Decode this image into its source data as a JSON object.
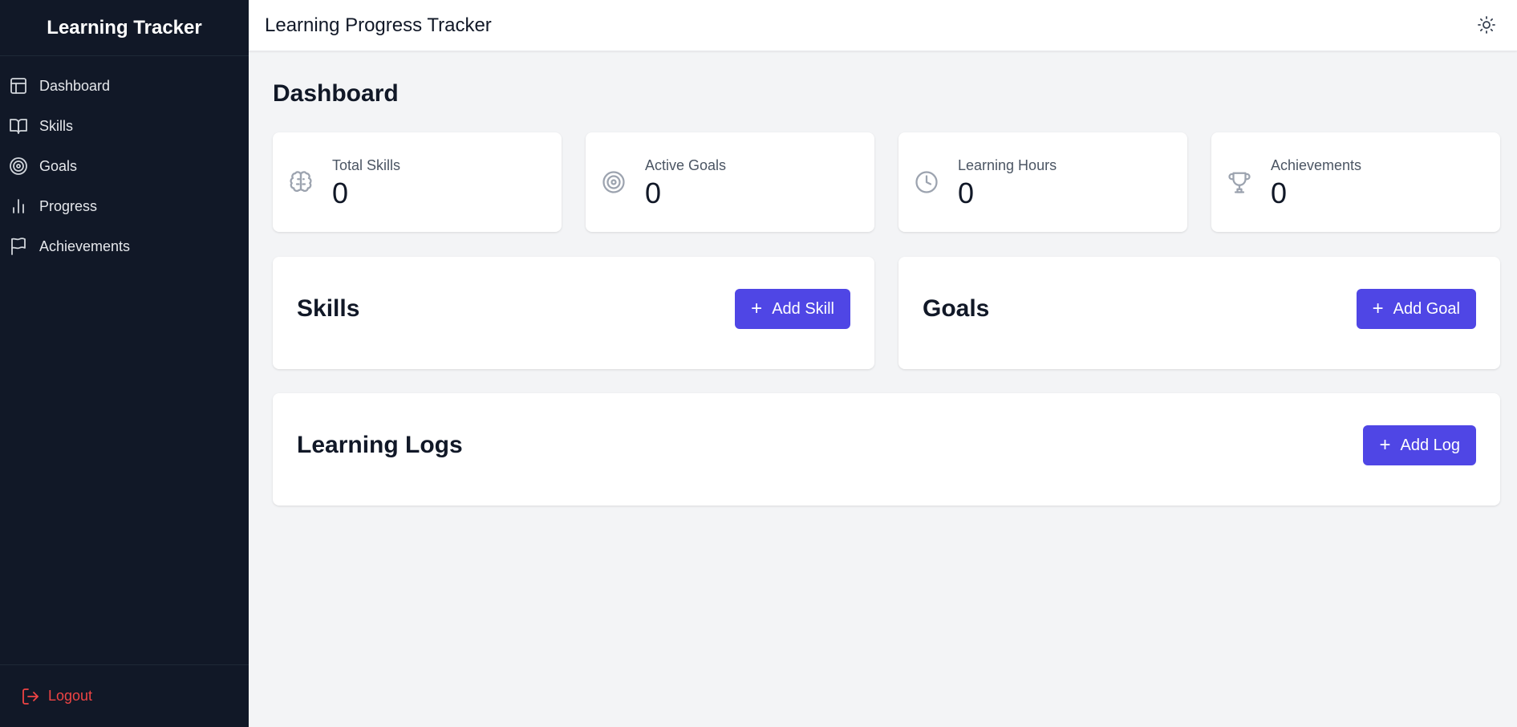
{
  "sidebar": {
    "brand": "Learning Tracker",
    "items": [
      {
        "label": "Dashboard",
        "icon": "layout-icon"
      },
      {
        "label": "Skills",
        "icon": "book-icon"
      },
      {
        "label": "Goals",
        "icon": "target-icon"
      },
      {
        "label": "Progress",
        "icon": "bar-chart-icon"
      },
      {
        "label": "Achievements",
        "icon": "flag-icon"
      }
    ],
    "logout_label": "Logout"
  },
  "header": {
    "title": "Learning Progress Tracker",
    "theme_toggle_icon": "sun-icon"
  },
  "main": {
    "page_title": "Dashboard",
    "stats": [
      {
        "label": "Total Skills",
        "value": "0",
        "icon": "brain-icon"
      },
      {
        "label": "Active Goals",
        "value": "0",
        "icon": "target-icon"
      },
      {
        "label": "Learning Hours",
        "value": "0",
        "icon": "clock-icon"
      },
      {
        "label": "Achievements",
        "value": "0",
        "icon": "trophy-icon"
      }
    ],
    "skills": {
      "title": "Skills",
      "button_label": "Add Skill"
    },
    "goals": {
      "title": "Goals",
      "button_label": "Add Goal"
    },
    "logs": {
      "title": "Learning Logs",
      "button_label": "Add Log"
    }
  },
  "colors": {
    "sidebar_bg": "#111827",
    "accent": "#4f46e5",
    "danger": "#ef4444",
    "page_bg": "#f3f4f6"
  }
}
